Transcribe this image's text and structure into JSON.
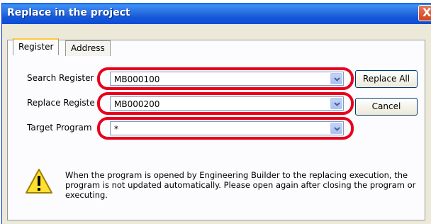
{
  "window": {
    "title": "Replace in the project",
    "close_glyph": "X"
  },
  "tabs": [
    {
      "label": "Register",
      "active": true
    },
    {
      "label": "Address",
      "active": false
    }
  ],
  "form": {
    "search_register": {
      "label": "Search Register",
      "value": "MB000100"
    },
    "replace_register": {
      "label": "Replace Registe",
      "value": "MB000200"
    },
    "target_program": {
      "label": "Target Program",
      "value": "*"
    }
  },
  "buttons": {
    "replace_all": "Replace All",
    "cancel": "Cancel"
  },
  "warning": {
    "icon": "warning-icon",
    "text": "When the program is opened by Engineering Builder to the replacing execution, the program is not updated automatically. Please open again after closing the program or executing."
  },
  "colors": {
    "highlight": "#e8001c",
    "titlebar": "#1456d8",
    "dialog_bg": "#ece9d8"
  }
}
